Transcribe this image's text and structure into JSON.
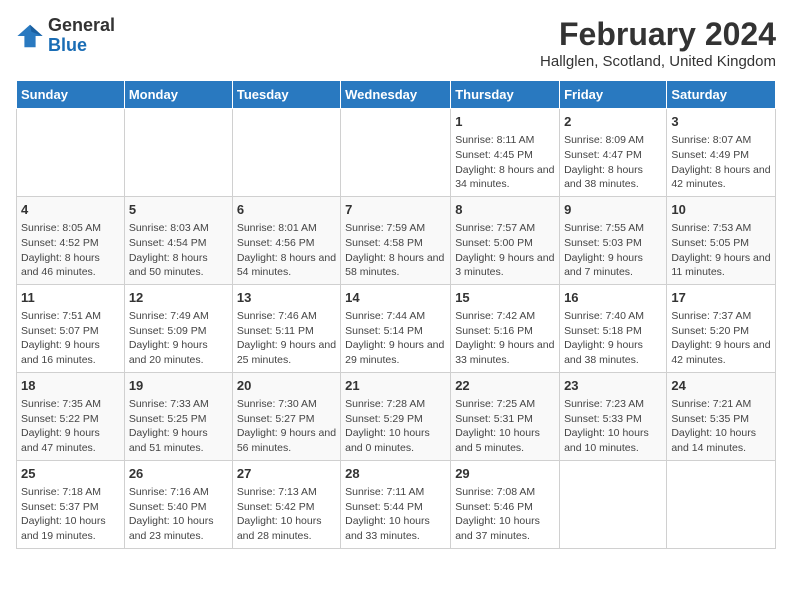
{
  "header": {
    "logo_general": "General",
    "logo_blue": "Blue",
    "month_year": "February 2024",
    "location": "Hallglen, Scotland, United Kingdom"
  },
  "days_of_week": [
    "Sunday",
    "Monday",
    "Tuesday",
    "Wednesday",
    "Thursday",
    "Friday",
    "Saturday"
  ],
  "weeks": [
    [
      {
        "day": "",
        "content": ""
      },
      {
        "day": "",
        "content": ""
      },
      {
        "day": "",
        "content": ""
      },
      {
        "day": "",
        "content": ""
      },
      {
        "day": "1",
        "content": "Sunrise: 8:11 AM\nSunset: 4:45 PM\nDaylight: 8 hours and 34 minutes."
      },
      {
        "day": "2",
        "content": "Sunrise: 8:09 AM\nSunset: 4:47 PM\nDaylight: 8 hours and 38 minutes."
      },
      {
        "day": "3",
        "content": "Sunrise: 8:07 AM\nSunset: 4:49 PM\nDaylight: 8 hours and 42 minutes."
      }
    ],
    [
      {
        "day": "4",
        "content": "Sunrise: 8:05 AM\nSunset: 4:52 PM\nDaylight: 8 hours and 46 minutes."
      },
      {
        "day": "5",
        "content": "Sunrise: 8:03 AM\nSunset: 4:54 PM\nDaylight: 8 hours and 50 minutes."
      },
      {
        "day": "6",
        "content": "Sunrise: 8:01 AM\nSunset: 4:56 PM\nDaylight: 8 hours and 54 minutes."
      },
      {
        "day": "7",
        "content": "Sunrise: 7:59 AM\nSunset: 4:58 PM\nDaylight: 8 hours and 58 minutes."
      },
      {
        "day": "8",
        "content": "Sunrise: 7:57 AM\nSunset: 5:00 PM\nDaylight: 9 hours and 3 minutes."
      },
      {
        "day": "9",
        "content": "Sunrise: 7:55 AM\nSunset: 5:03 PM\nDaylight: 9 hours and 7 minutes."
      },
      {
        "day": "10",
        "content": "Sunrise: 7:53 AM\nSunset: 5:05 PM\nDaylight: 9 hours and 11 minutes."
      }
    ],
    [
      {
        "day": "11",
        "content": "Sunrise: 7:51 AM\nSunset: 5:07 PM\nDaylight: 9 hours and 16 minutes."
      },
      {
        "day": "12",
        "content": "Sunrise: 7:49 AM\nSunset: 5:09 PM\nDaylight: 9 hours and 20 minutes."
      },
      {
        "day": "13",
        "content": "Sunrise: 7:46 AM\nSunset: 5:11 PM\nDaylight: 9 hours and 25 minutes."
      },
      {
        "day": "14",
        "content": "Sunrise: 7:44 AM\nSunset: 5:14 PM\nDaylight: 9 hours and 29 minutes."
      },
      {
        "day": "15",
        "content": "Sunrise: 7:42 AM\nSunset: 5:16 PM\nDaylight: 9 hours and 33 minutes."
      },
      {
        "day": "16",
        "content": "Sunrise: 7:40 AM\nSunset: 5:18 PM\nDaylight: 9 hours and 38 minutes."
      },
      {
        "day": "17",
        "content": "Sunrise: 7:37 AM\nSunset: 5:20 PM\nDaylight: 9 hours and 42 minutes."
      }
    ],
    [
      {
        "day": "18",
        "content": "Sunrise: 7:35 AM\nSunset: 5:22 PM\nDaylight: 9 hours and 47 minutes."
      },
      {
        "day": "19",
        "content": "Sunrise: 7:33 AM\nSunset: 5:25 PM\nDaylight: 9 hours and 51 minutes."
      },
      {
        "day": "20",
        "content": "Sunrise: 7:30 AM\nSunset: 5:27 PM\nDaylight: 9 hours and 56 minutes."
      },
      {
        "day": "21",
        "content": "Sunrise: 7:28 AM\nSunset: 5:29 PM\nDaylight: 10 hours and 0 minutes."
      },
      {
        "day": "22",
        "content": "Sunrise: 7:25 AM\nSunset: 5:31 PM\nDaylight: 10 hours and 5 minutes."
      },
      {
        "day": "23",
        "content": "Sunrise: 7:23 AM\nSunset: 5:33 PM\nDaylight: 10 hours and 10 minutes."
      },
      {
        "day": "24",
        "content": "Sunrise: 7:21 AM\nSunset: 5:35 PM\nDaylight: 10 hours and 14 minutes."
      }
    ],
    [
      {
        "day": "25",
        "content": "Sunrise: 7:18 AM\nSunset: 5:37 PM\nDaylight: 10 hours and 19 minutes."
      },
      {
        "day": "26",
        "content": "Sunrise: 7:16 AM\nSunset: 5:40 PM\nDaylight: 10 hours and 23 minutes."
      },
      {
        "day": "27",
        "content": "Sunrise: 7:13 AM\nSunset: 5:42 PM\nDaylight: 10 hours and 28 minutes."
      },
      {
        "day": "28",
        "content": "Sunrise: 7:11 AM\nSunset: 5:44 PM\nDaylight: 10 hours and 33 minutes."
      },
      {
        "day": "29",
        "content": "Sunrise: 7:08 AM\nSunset: 5:46 PM\nDaylight: 10 hours and 37 minutes."
      },
      {
        "day": "",
        "content": ""
      },
      {
        "day": "",
        "content": ""
      }
    ]
  ]
}
